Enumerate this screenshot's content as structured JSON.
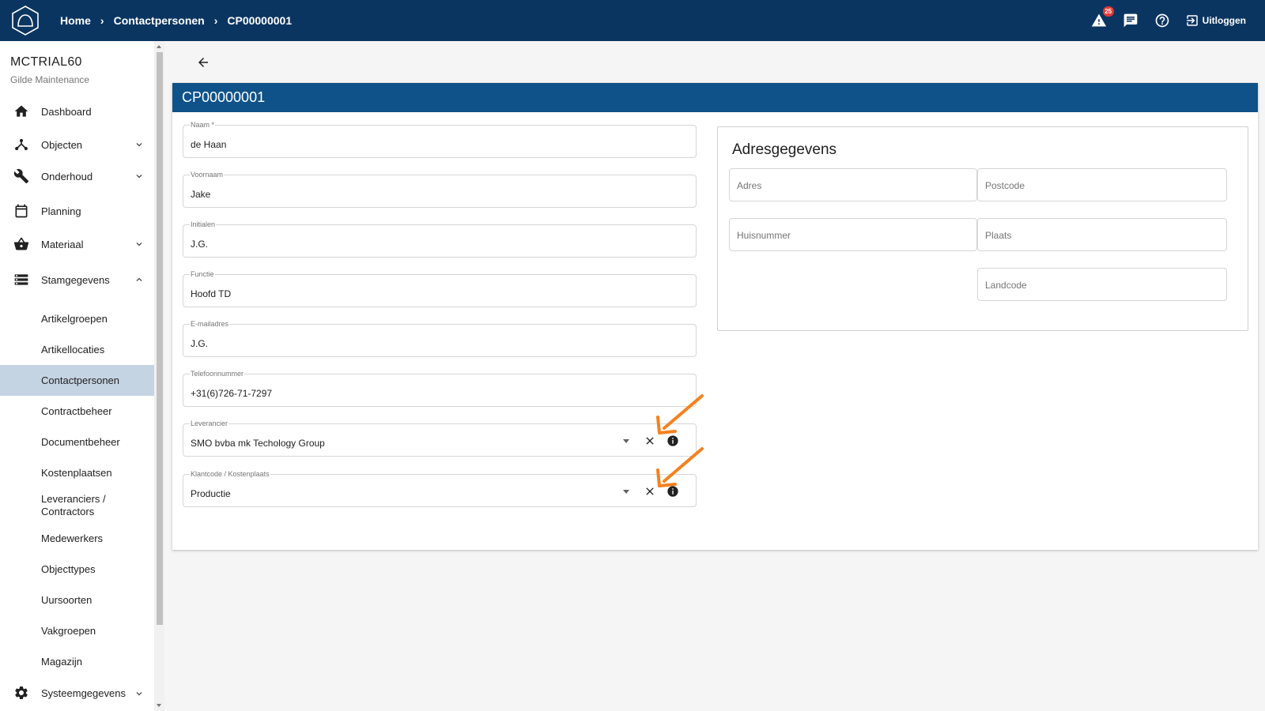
{
  "topbar": {
    "breadcrumb": [
      "Home",
      "Contactpersonen",
      "CP00000001"
    ],
    "alert_count": "25",
    "logout_label": "Uitloggen"
  },
  "sidebar": {
    "tenant_name": "MCTRIAL60",
    "tenant_sub": "Gilde Maintenance",
    "items": [
      {
        "label": "Dashboard",
        "icon": "home-icon"
      },
      {
        "label": "Objecten",
        "icon": "hierarchy-icon"
      },
      {
        "label": "Onderhoud",
        "icon": "wrench-icon"
      },
      {
        "label": "Planning",
        "icon": "calendar-icon"
      },
      {
        "label": "Materiaal",
        "icon": "basket-icon"
      },
      {
        "label": "Stamgegevens",
        "icon": "storage-icon"
      }
    ],
    "sub_items": [
      "Artikelgroepen",
      "Artikellocaties",
      "Contactpersonen",
      "Contractbeheer",
      "Documentbeheer",
      "Kostenplaatsen",
      "Leveranciers / Contractors",
      "Medewerkers",
      "Objecttypes",
      "Uursoorten",
      "Vakgroepen",
      "Magazijn"
    ],
    "bottom_item": {
      "label": "Systeemgegevens",
      "icon": "gears-icon"
    }
  },
  "card": {
    "title": "CP00000001",
    "fields": [
      {
        "label": "Naam *",
        "value": "de Haan"
      },
      {
        "label": "Voornaam",
        "value": "Jake"
      },
      {
        "label": "Initialen",
        "value": "J.G."
      },
      {
        "label": "Functie",
        "value": "Hoofd TD"
      },
      {
        "label": "E-mailadres",
        "value": "J.G."
      },
      {
        "label": "Telefoonnummer",
        "value": "+31(6)726-71-7297"
      },
      {
        "label": "Leverancier",
        "value": "SMO bvba mk Techology Group"
      },
      {
        "label": "Klantcode / Kostenplaats",
        "value": "Productie"
      }
    ],
    "address": {
      "title": "Adresgegevens",
      "placeholders": {
        "adres": "Adres",
        "postcode": "Postcode",
        "huisnummer": "Huisnummer",
        "plaats": "Plaats",
        "landcode": "Landcode"
      }
    }
  },
  "colors": {
    "topbar": "#0b3561",
    "card_header": "#0f5289",
    "active_nav": "#c5d4e3",
    "annotation_arrow": "#f5811f",
    "badge": "#e53935"
  }
}
